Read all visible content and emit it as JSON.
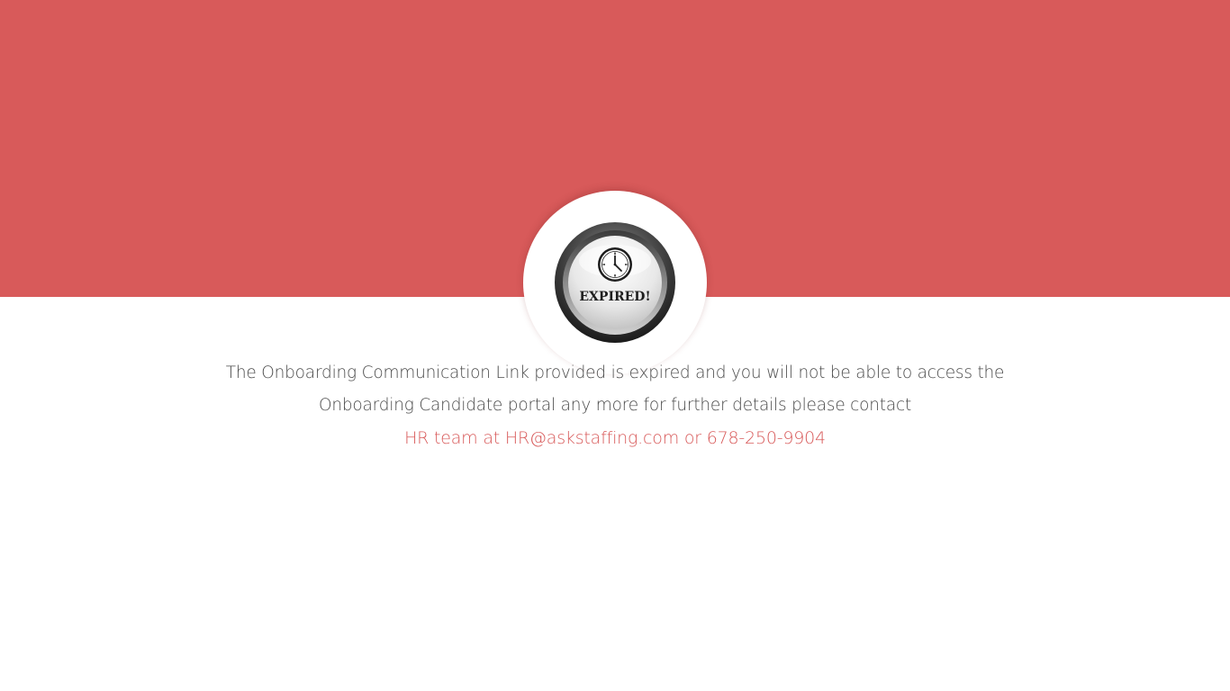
{
  "colors": {
    "banner": "#d85a5a",
    "accent": "#d85a5a",
    "background": "#ffffff",
    "body_text": "#4a4a4a"
  },
  "badge": {
    "icon": "clock-icon",
    "label": "EXPIRED!"
  },
  "message": {
    "line1": "The Onboarding Communication Link provided is expired and you will not be able to access the",
    "line2": "Onboarding Candidate portal any more for further details please contact"
  },
  "contact": {
    "prefix": "HR team at ",
    "email": "HR@askstaffing.com",
    "separator": " or ",
    "phone": "678-250-9904"
  }
}
